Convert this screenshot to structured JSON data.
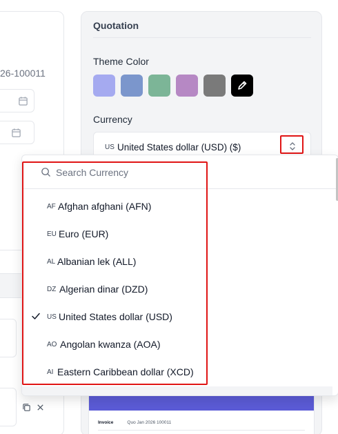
{
  "left_panel": {
    "quote_number_fragment": "26-100011"
  },
  "quotation": {
    "title": "Quotation",
    "theme_label": "Theme Color",
    "theme_colors": [
      "#a5aaf0",
      "#7b96cc",
      "#7cb597",
      "#b688c4",
      "#7a7a7a"
    ],
    "custom_color": "#000000",
    "currency_label": "Currency",
    "selected_code": "US",
    "selected_name": "United States dollar (USD) ($)"
  },
  "dropdown": {
    "search_placeholder": "Search Currency",
    "options": [
      {
        "code": "AF",
        "label": "Afghan afghani (AFN)",
        "selected": false
      },
      {
        "code": "EU",
        "label": "Euro (EUR)",
        "selected": false
      },
      {
        "code": "AL",
        "label": "Albanian lek (ALL)",
        "selected": false
      },
      {
        "code": "DZ",
        "label": "Algerian dinar (DZD)",
        "selected": false
      },
      {
        "code": "US",
        "label": "United States dollar (USD)",
        "selected": true
      },
      {
        "code": "AO",
        "label": "Angolan kwanza (AOA)",
        "selected": false
      },
      {
        "code": "AI",
        "label": "Eastern Caribbean dollar (XCD)",
        "selected": false
      }
    ]
  },
  "preview": {
    "invoice_label": "Invoice",
    "invoice_value": "Quo Jan 2026 100011"
  },
  "colors": {
    "highlight": "#e01414",
    "accent": "#5b5bd6"
  }
}
